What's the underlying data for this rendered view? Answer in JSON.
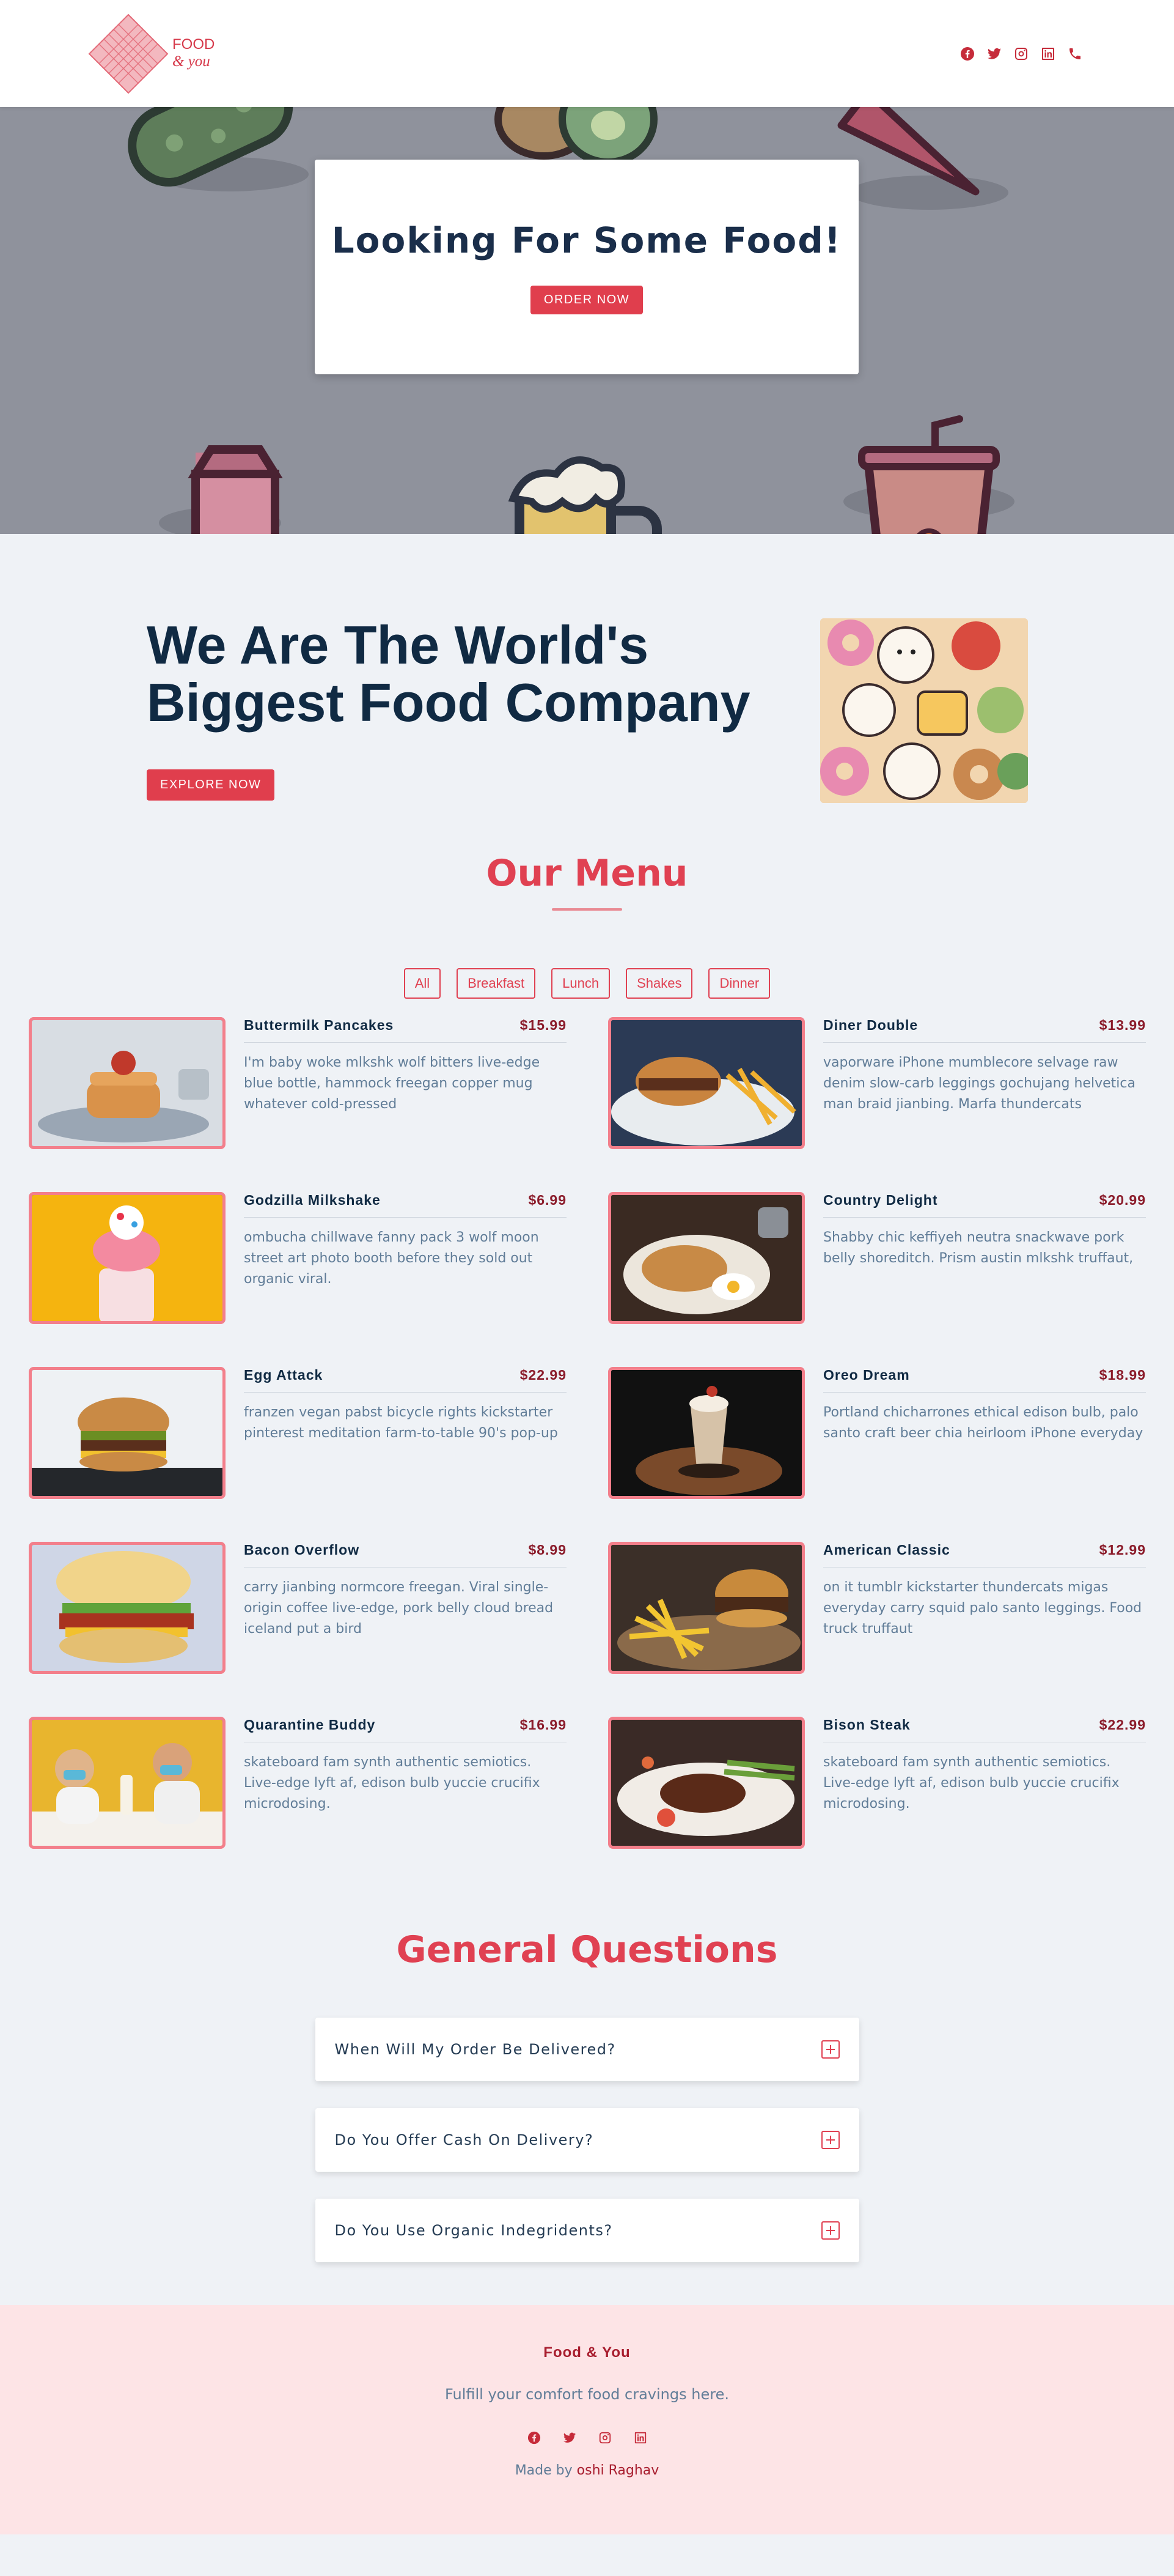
{
  "brand": {
    "line1": "FOOD",
    "line2": "& you"
  },
  "social_icons": [
    "facebook-icon",
    "twitter-icon",
    "instagram-icon",
    "linkedin-icon",
    "phone-icon"
  ],
  "hero": {
    "title": "Looking For Some Food!",
    "button": "ORDER NOW",
    "background": "#8f929c"
  },
  "about": {
    "title": "We Are The World's Biggest Food Company",
    "button": "EXPLORE NOW"
  },
  "menu": {
    "title": "Our Menu",
    "filters": [
      "All",
      "Breakfast",
      "Lunch",
      "Shakes",
      "Dinner"
    ],
    "items": [
      {
        "name": "Buttermilk Pancakes",
        "price": "$15.99",
        "desc": "I'm baby woke mlkshk wolf bitters live-edge blue bottle, hammock freegan copper mug whatever cold-pressed"
      },
      {
        "name": "Diner Double",
        "price": "$13.99",
        "desc": "vaporware iPhone mumblecore selvage raw denim slow-carb leggings gochujang helvetica man braid jianbing. Marfa thundercats"
      },
      {
        "name": "Godzilla Milkshake",
        "price": "$6.99",
        "desc": "ombucha chillwave fanny pack 3 wolf moon street art photo booth before they sold out organic viral."
      },
      {
        "name": "Country Delight",
        "price": "$20.99",
        "desc": "Shabby chic keffiyeh neutra snackwave pork belly shoreditch. Prism austin mlkshk truffaut,"
      },
      {
        "name": "Egg Attack",
        "price": "$22.99",
        "desc": "franzen vegan pabst bicycle rights kickstarter pinterest meditation farm-to-table 90's pop-up"
      },
      {
        "name": "Oreo Dream",
        "price": "$18.99",
        "desc": "Portland chicharrones ethical edison bulb, palo santo craft beer chia heirloom iPhone everyday"
      },
      {
        "name": "Bacon Overflow",
        "price": "$8.99",
        "desc": "carry jianbing normcore freegan. Viral single-origin coffee live-edge, pork belly cloud bread iceland put a bird"
      },
      {
        "name": "American Classic",
        "price": "$12.99",
        "desc": "on it tumblr kickstarter thundercats migas everyday carry squid palo santo leggings. Food truck truffaut"
      },
      {
        "name": "Quarantine Buddy",
        "price": "$16.99",
        "desc": "skateboard fam synth authentic semiotics. Live-edge lyft af, edison bulb yuccie crucifix microdosing."
      },
      {
        "name": "Bison Steak",
        "price": "$22.99",
        "desc": "skateboard fam synth authentic semiotics. Live-edge lyft af, edison bulb yuccie crucifix microdosing."
      }
    ]
  },
  "faq": {
    "title": "General Questions",
    "questions": [
      "When Will My Order Be Delivered?",
      "Do You Offer Cash On Delivery?",
      "Do You Use Organic Indegridents?"
    ]
  },
  "footer": {
    "title": "Food & You",
    "text": "Fulfill your comfort food cravings here.",
    "credit_prefix": "Made by",
    "credit_name": "oshi Raghav"
  },
  "colors": {
    "accent": "#e04152",
    "dark": "#102a43",
    "muted": "#617d98",
    "footer_bg": "#fde4e6"
  }
}
